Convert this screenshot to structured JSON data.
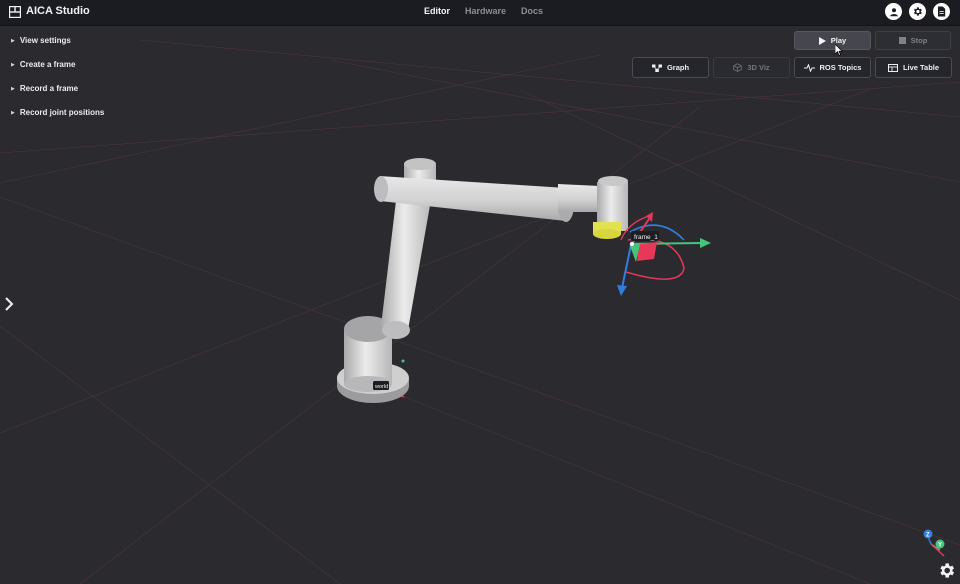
{
  "header": {
    "app_title": "AICA Studio",
    "tabs": [
      {
        "label": "Editor",
        "active": true
      },
      {
        "label": "Hardware",
        "active": false
      },
      {
        "label": "Docs",
        "active": false
      }
    ],
    "icons": [
      "user-icon",
      "gear-icon",
      "document-icon"
    ]
  },
  "sidebar": {
    "items": [
      {
        "label": "View settings"
      },
      {
        "label": "Create a frame"
      },
      {
        "label": "Record a frame"
      },
      {
        "label": "Record joint positions"
      }
    ]
  },
  "controls": {
    "play_label": "Play",
    "stop_label": "Stop"
  },
  "views": [
    {
      "label": "Graph",
      "enabled": true
    },
    {
      "label": "3D Viz",
      "enabled": false
    },
    {
      "label": "ROS Topics",
      "enabled": true
    },
    {
      "label": "Live Table",
      "enabled": true
    }
  ],
  "scene": {
    "frames": [
      {
        "label": "frame_1"
      },
      {
        "label": "world"
      }
    ],
    "axes": {
      "z": "Z",
      "y": "Y"
    },
    "colors": {
      "background": "#2b2a2f",
      "grid_line": "#5a3a3e",
      "robot_body": "#d9d9d9",
      "tool_tip": "#e2e24e",
      "axis_x": "#e8385a",
      "axis_y": "#45c57a",
      "axis_z": "#2f7fe0"
    }
  }
}
